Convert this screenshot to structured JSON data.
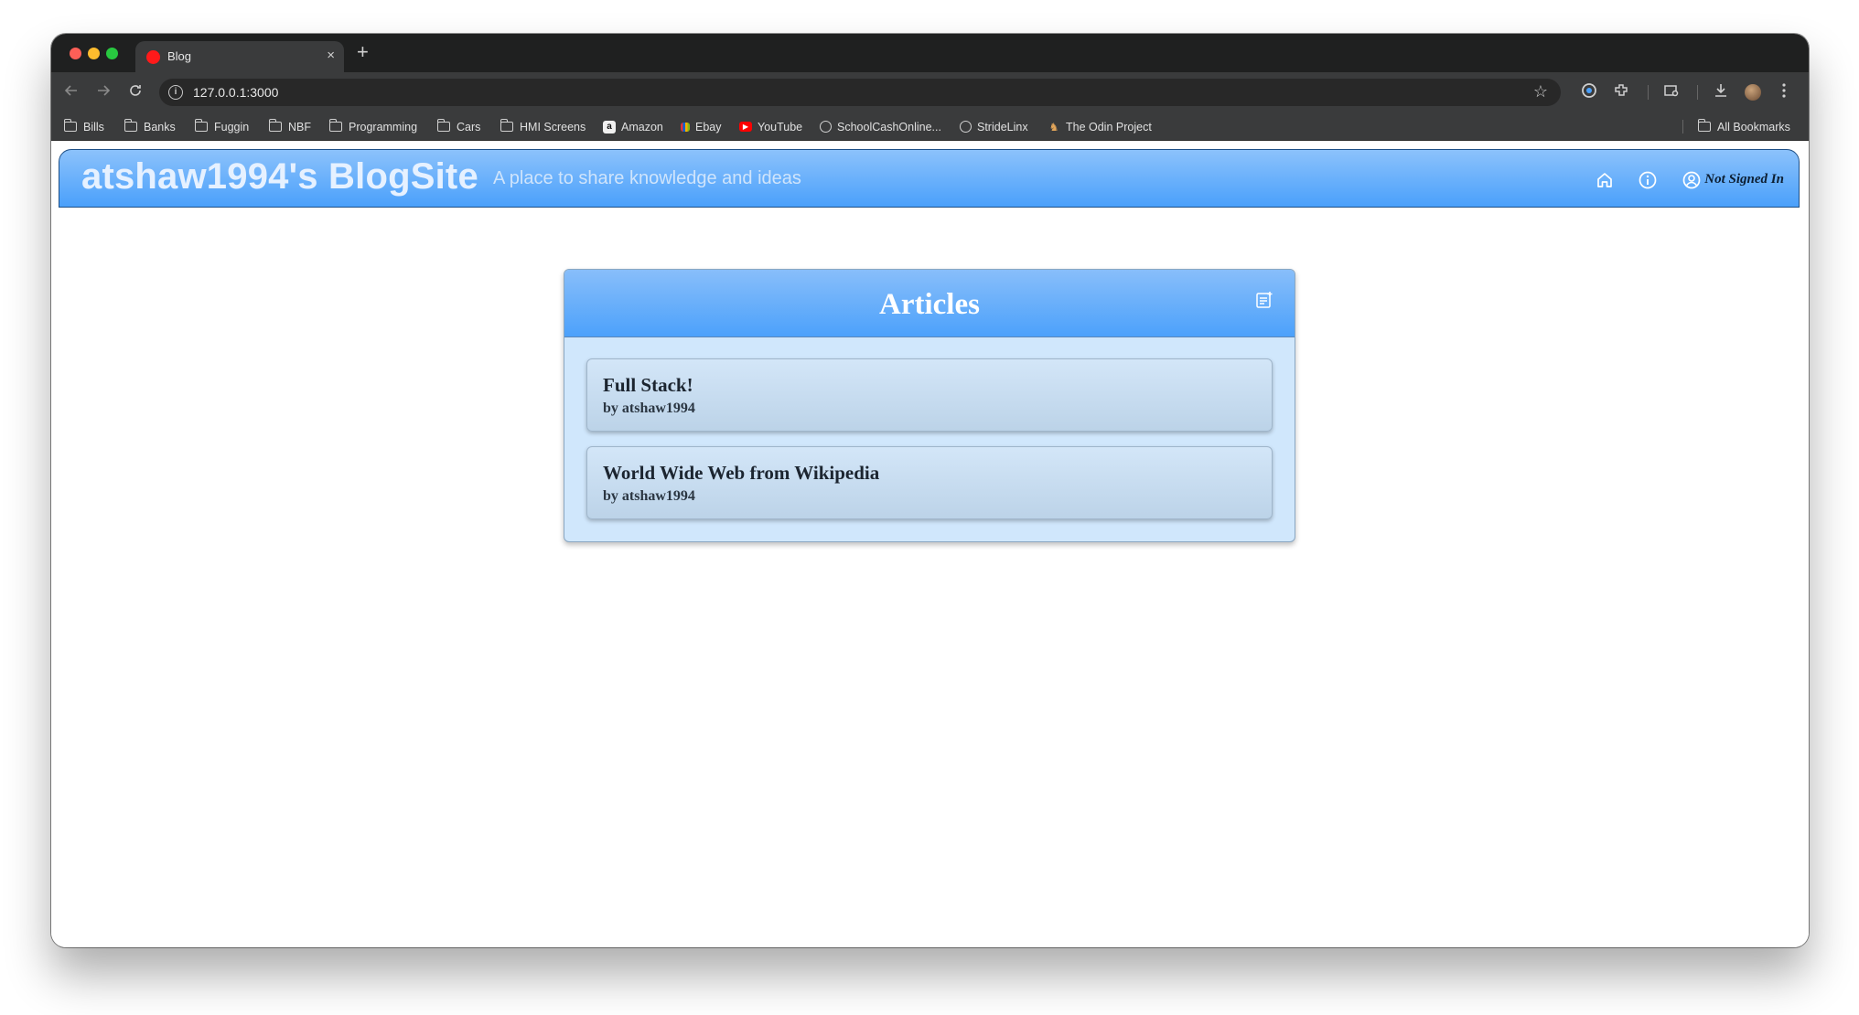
{
  "browser": {
    "tab": {
      "title": "Blog",
      "close_glyph": "×"
    },
    "new_tab_glyph": "+",
    "address_bar": {
      "url": "127.0.0.1:3000"
    },
    "bookmarks": [
      {
        "label": "Bills",
        "icon": "folder-icon"
      },
      {
        "label": "Banks",
        "icon": "folder-icon"
      },
      {
        "label": "Fuggin",
        "icon": "folder-icon"
      },
      {
        "label": "NBF",
        "icon": "folder-icon"
      },
      {
        "label": "Programming",
        "icon": "folder-icon"
      },
      {
        "label": "Cars",
        "icon": "folder-icon"
      },
      {
        "label": "HMI Screens",
        "icon": "folder-icon"
      },
      {
        "label": "Amazon",
        "icon": "amazon-favicon"
      },
      {
        "label": "Ebay",
        "icon": "ebay-favicon"
      },
      {
        "label": "YouTube",
        "icon": "youtube-favicon"
      },
      {
        "label": "SchoolCashOnline...",
        "icon": "globe-icon"
      },
      {
        "label": "StrideLinx",
        "icon": "globe-icon"
      },
      {
        "label": "The Odin Project",
        "icon": "odin-favicon"
      }
    ],
    "all_bookmarks": "All Bookmarks"
  },
  "site": {
    "title": "atshaw1994's BlogSite",
    "tagline": "A place to share knowledge and ideas",
    "signin_status": "Not Signed In"
  },
  "articles": {
    "heading": "Articles",
    "items": [
      {
        "title": "Full Stack!",
        "author": "by atshaw1994"
      },
      {
        "title": "World Wide Web from Wikipedia",
        "author": "by atshaw1994"
      }
    ]
  },
  "colors": {
    "header_gradient_top": "#8cc2fb",
    "header_gradient_bottom": "#4aa0fb",
    "panel_background": "#d0e7fc",
    "card_background": "#c9dcf0"
  }
}
